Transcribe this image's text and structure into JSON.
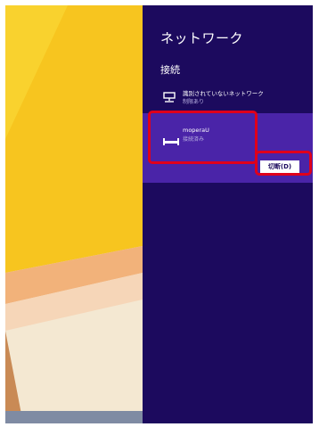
{
  "panel": {
    "title": "ネットワーク",
    "section_header": "接続"
  },
  "networks": [
    {
      "name": "識別されていないネットワーク",
      "status": "制限あり",
      "icon": "wired-network-icon"
    },
    {
      "name": "moperaU",
      "status": "接続済み",
      "icon": "modem-connection-icon",
      "selected": true,
      "action_label": "切断(D)"
    }
  ],
  "colors": {
    "panel_background": "#1c0a5e",
    "selected_item": "#4a24a8",
    "wallpaper_yellow": "#f6c21e",
    "highlight_red": "#e0001b"
  }
}
